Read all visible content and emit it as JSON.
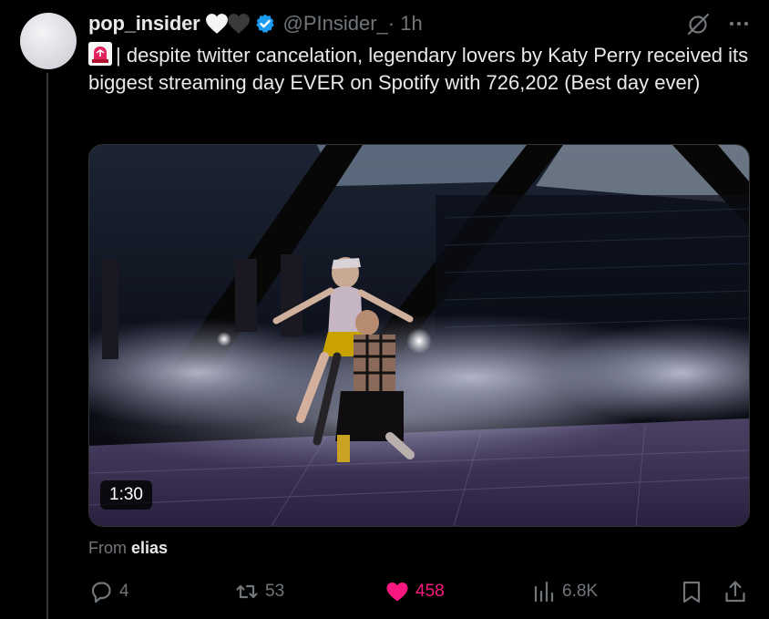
{
  "tweet": {
    "author_name": "pop_insider",
    "handle": "@PInsider_",
    "time": "· 1h",
    "text": "| despite twitter cancelation, legendary lovers by Katy Perry received its biggest streaming day EVER on Spotify with 726,202 (Best day ever)"
  },
  "media": {
    "duration": "1:30"
  },
  "attribution": {
    "prefix": "From",
    "source": "elias"
  },
  "actions": {
    "replies": "4",
    "reposts": "53",
    "likes": "458",
    "views": "6.8K"
  },
  "colors": {
    "background": "#000000",
    "text": "#e7e9ea",
    "muted": "#71767b",
    "like": "#f91880",
    "verified": "#1d9bf0"
  },
  "icons": [
    "white-heart-icon",
    "black-heart-icon",
    "verified-badge-icon",
    "grok-icon",
    "more-icon",
    "siren-emoji-icon",
    "reply-icon",
    "repost-icon",
    "like-icon",
    "views-icon",
    "bookmark-icon",
    "share-icon"
  ]
}
